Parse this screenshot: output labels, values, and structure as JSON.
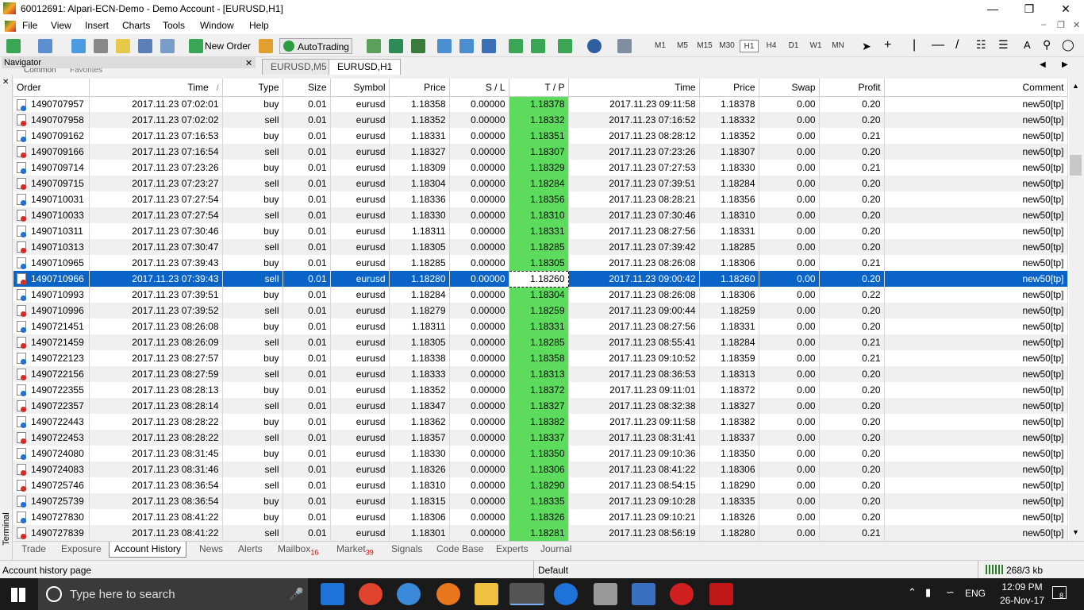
{
  "window": {
    "title": "60012691: Alpari-ECN-Demo - Demo Account - [EURUSD,H1]"
  },
  "menu": [
    "File",
    "View",
    "Insert",
    "Charts",
    "Tools",
    "Window",
    "Help"
  ],
  "toolbar": {
    "new_order": "New Order",
    "autotrading": "AutoTrading",
    "timeframes": [
      "M1",
      "M5",
      "M15",
      "M30",
      "H1",
      "H4",
      "D1",
      "W1",
      "MN"
    ],
    "active_timeframe": "H1"
  },
  "navigator": {
    "title": "Navigator",
    "tabs": [
      "Common",
      "Favorites"
    ]
  },
  "chart_tabs": [
    {
      "label": "EURUSD,M5",
      "active": false
    },
    {
      "label": "EURUSD,H1",
      "active": true
    }
  ],
  "terminal_label": "Terminal",
  "columns": [
    "Order",
    "Time",
    "Type",
    "Size",
    "Symbol",
    "Price",
    "S / L",
    "T / P",
    "Time",
    "Price",
    "Swap",
    "Profit",
    "Comment"
  ],
  "rows": [
    [
      "1490707957",
      "2017.11.23 07:02:01",
      "buy",
      "0.01",
      "eurusd",
      "1.18358",
      "0.00000",
      "1.18378",
      "2017.11.23 09:11:58",
      "1.18378",
      "0.00",
      "0.20",
      "new50[tp]"
    ],
    [
      "1490707958",
      "2017.11.23 07:02:02",
      "sell",
      "0.01",
      "eurusd",
      "1.18352",
      "0.00000",
      "1.18332",
      "2017.11.23 07:16:52",
      "1.18332",
      "0.00",
      "0.20",
      "new50[tp]"
    ],
    [
      "1490709162",
      "2017.11.23 07:16:53",
      "buy",
      "0.01",
      "eurusd",
      "1.18331",
      "0.00000",
      "1.18351",
      "2017.11.23 08:28:12",
      "1.18352",
      "0.00",
      "0.21",
      "new50[tp]"
    ],
    [
      "1490709166",
      "2017.11.23 07:16:54",
      "sell",
      "0.01",
      "eurusd",
      "1.18327",
      "0.00000",
      "1.18307",
      "2017.11.23 07:23:26",
      "1.18307",
      "0.00",
      "0.20",
      "new50[tp]"
    ],
    [
      "1490709714",
      "2017.11.23 07:23:26",
      "buy",
      "0.01",
      "eurusd",
      "1.18309",
      "0.00000",
      "1.18329",
      "2017.11.23 07:27:53",
      "1.18330",
      "0.00",
      "0.21",
      "new50[tp]"
    ],
    [
      "1490709715",
      "2017.11.23 07:23:27",
      "sell",
      "0.01",
      "eurusd",
      "1.18304",
      "0.00000",
      "1.18284",
      "2017.11.23 07:39:51",
      "1.18284",
      "0.00",
      "0.20",
      "new50[tp]"
    ],
    [
      "1490710031",
      "2017.11.23 07:27:54",
      "buy",
      "0.01",
      "eurusd",
      "1.18336",
      "0.00000",
      "1.18356",
      "2017.11.23 08:28:21",
      "1.18356",
      "0.00",
      "0.20",
      "new50[tp]"
    ],
    [
      "1490710033",
      "2017.11.23 07:27:54",
      "sell",
      "0.01",
      "eurusd",
      "1.18330",
      "0.00000",
      "1.18310",
      "2017.11.23 07:30:46",
      "1.18310",
      "0.00",
      "0.20",
      "new50[tp]"
    ],
    [
      "1490710311",
      "2017.11.23 07:30:46",
      "buy",
      "0.01",
      "eurusd",
      "1.18311",
      "0.00000",
      "1.18331",
      "2017.11.23 08:27:56",
      "1.18331",
      "0.00",
      "0.20",
      "new50[tp]"
    ],
    [
      "1490710313",
      "2017.11.23 07:30:47",
      "sell",
      "0.01",
      "eurusd",
      "1.18305",
      "0.00000",
      "1.18285",
      "2017.11.23 07:39:42",
      "1.18285",
      "0.00",
      "0.20",
      "new50[tp]"
    ],
    [
      "1490710965",
      "2017.11.23 07:39:43",
      "buy",
      "0.01",
      "eurusd",
      "1.18285",
      "0.00000",
      "1.18305",
      "2017.11.23 08:26:08",
      "1.18306",
      "0.00",
      "0.21",
      "new50[tp]"
    ],
    [
      "1490710966",
      "2017.11.23 07:39:43",
      "sell",
      "0.01",
      "eurusd",
      "1.18280",
      "0.00000",
      "1.18260",
      "2017.11.23 09:00:42",
      "1.18260",
      "0.00",
      "0.20",
      "new50[tp]"
    ],
    [
      "1490710993",
      "2017.11.23 07:39:51",
      "buy",
      "0.01",
      "eurusd",
      "1.18284",
      "0.00000",
      "1.18304",
      "2017.11.23 08:26:08",
      "1.18306",
      "0.00",
      "0.22",
      "new50[tp]"
    ],
    [
      "1490710996",
      "2017.11.23 07:39:52",
      "sell",
      "0.01",
      "eurusd",
      "1.18279",
      "0.00000",
      "1.18259",
      "2017.11.23 09:00:44",
      "1.18259",
      "0.00",
      "0.20",
      "new50[tp]"
    ],
    [
      "1490721451",
      "2017.11.23 08:26:08",
      "buy",
      "0.01",
      "eurusd",
      "1.18311",
      "0.00000",
      "1.18331",
      "2017.11.23 08:27:56",
      "1.18331",
      "0.00",
      "0.20",
      "new50[tp]"
    ],
    [
      "1490721459",
      "2017.11.23 08:26:09",
      "sell",
      "0.01",
      "eurusd",
      "1.18305",
      "0.00000",
      "1.18285",
      "2017.11.23 08:55:41",
      "1.18284",
      "0.00",
      "0.21",
      "new50[tp]"
    ],
    [
      "1490722123",
      "2017.11.23 08:27:57",
      "buy",
      "0.01",
      "eurusd",
      "1.18338",
      "0.00000",
      "1.18358",
      "2017.11.23 09:10:52",
      "1.18359",
      "0.00",
      "0.21",
      "new50[tp]"
    ],
    [
      "1490722156",
      "2017.11.23 08:27:59",
      "sell",
      "0.01",
      "eurusd",
      "1.18333",
      "0.00000",
      "1.18313",
      "2017.11.23 08:36:53",
      "1.18313",
      "0.00",
      "0.20",
      "new50[tp]"
    ],
    [
      "1490722355",
      "2017.11.23 08:28:13",
      "buy",
      "0.01",
      "eurusd",
      "1.18352",
      "0.00000",
      "1.18372",
      "2017.11.23 09:11:01",
      "1.18372",
      "0.00",
      "0.20",
      "new50[tp]"
    ],
    [
      "1490722357",
      "2017.11.23 08:28:14",
      "sell",
      "0.01",
      "eurusd",
      "1.18347",
      "0.00000",
      "1.18327",
      "2017.11.23 08:32:38",
      "1.18327",
      "0.00",
      "0.20",
      "new50[tp]"
    ],
    [
      "1490722443",
      "2017.11.23 08:28:22",
      "buy",
      "0.01",
      "eurusd",
      "1.18362",
      "0.00000",
      "1.18382",
      "2017.11.23 09:11:58",
      "1.18382",
      "0.00",
      "0.20",
      "new50[tp]"
    ],
    [
      "1490722453",
      "2017.11.23 08:28:22",
      "sell",
      "0.01",
      "eurusd",
      "1.18357",
      "0.00000",
      "1.18337",
      "2017.11.23 08:31:41",
      "1.18337",
      "0.00",
      "0.20",
      "new50[tp]"
    ],
    [
      "1490724080",
      "2017.11.23 08:31:45",
      "buy",
      "0.01",
      "eurusd",
      "1.18330",
      "0.00000",
      "1.18350",
      "2017.11.23 09:10:36",
      "1.18350",
      "0.00",
      "0.20",
      "new50[tp]"
    ],
    [
      "1490724083",
      "2017.11.23 08:31:46",
      "sell",
      "0.01",
      "eurusd",
      "1.18326",
      "0.00000",
      "1.18306",
      "2017.11.23 08:41:22",
      "1.18306",
      "0.00",
      "0.20",
      "new50[tp]"
    ],
    [
      "1490725746",
      "2017.11.23 08:36:54",
      "sell",
      "0.01",
      "eurusd",
      "1.18310",
      "0.00000",
      "1.18290",
      "2017.11.23 08:54:15",
      "1.18290",
      "0.00",
      "0.20",
      "new50[tp]"
    ],
    [
      "1490725739",
      "2017.11.23 08:36:54",
      "buy",
      "0.01",
      "eurusd",
      "1.18315",
      "0.00000",
      "1.18335",
      "2017.11.23 09:10:28",
      "1.18335",
      "0.00",
      "0.20",
      "new50[tp]"
    ],
    [
      "1490727830",
      "2017.11.23 08:41:22",
      "buy",
      "0.01",
      "eurusd",
      "1.18306",
      "0.00000",
      "1.18326",
      "2017.11.23 09:10:21",
      "1.18326",
      "0.00",
      "0.20",
      "new50[tp]"
    ],
    [
      "1490727839",
      "2017.11.23 08:41:22",
      "sell",
      "0.01",
      "eurusd",
      "1.18301",
      "0.00000",
      "1.18281",
      "2017.11.23 08:56:19",
      "1.18280",
      "0.00",
      "0.21",
      "new50[tp]"
    ]
  ],
  "bottom_tabs": [
    {
      "label": "Trade",
      "badge": ""
    },
    {
      "label": "Exposure",
      "badge": ""
    },
    {
      "label": "Account History",
      "badge": ""
    },
    {
      "label": "News",
      "badge": ""
    },
    {
      "label": "Alerts",
      "badge": ""
    },
    {
      "label": "Mailbox",
      "badge": "16"
    },
    {
      "label": "Market",
      "badge": "39"
    },
    {
      "label": "Signals",
      "badge": ""
    },
    {
      "label": "Code Base",
      "badge": ""
    },
    {
      "label": "Experts",
      "badge": ""
    },
    {
      "label": "Journal",
      "badge": ""
    }
  ],
  "active_bottom_tab": "Account History",
  "status": {
    "left": "Account history page",
    "profile": "Default",
    "traffic": "268/3 kb"
  },
  "taskbar": {
    "search_placeholder": "Type here to search",
    "lang": "ENG",
    "time": "12:09 PM",
    "date": "26-Nov-17",
    "notif": "8"
  },
  "colors": {
    "selected_row": "#0a64c8",
    "tp_highlight": "#5ddb5d",
    "buy_dot": "#1e6fd6",
    "sell_dot": "#d03020"
  }
}
